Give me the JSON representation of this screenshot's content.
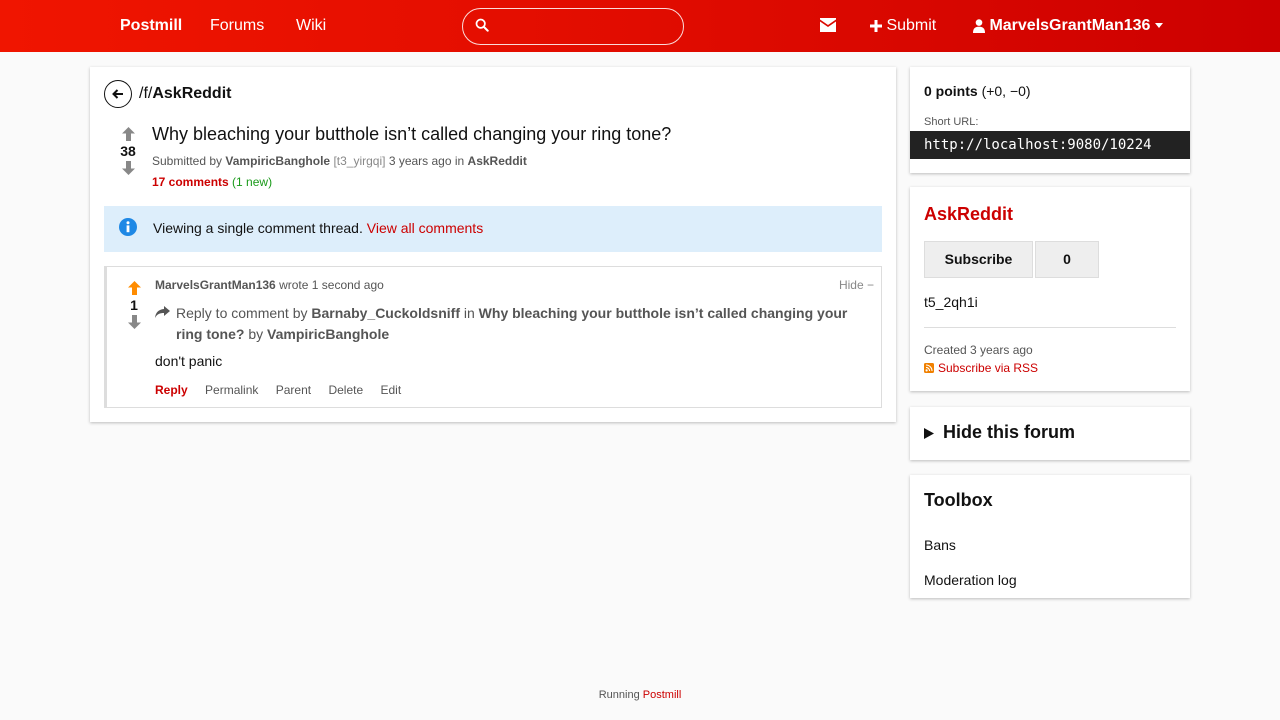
{
  "colors": {
    "brand": "#e10c00",
    "accent": "#cc0000",
    "upvote": "#ff8c00",
    "new": "#1a9a1a",
    "info": "#1e88e5"
  },
  "header": {
    "brand": "Postmill",
    "nav": {
      "forums": "Forums",
      "wiki": "Wiki"
    },
    "search": {
      "value": "",
      "placeholder": ""
    },
    "submit": "Submit",
    "user": "MarvelsGrantMan136",
    "icons": {
      "search": "search-icon",
      "mail": "envelope-icon",
      "submit": "plus-icon",
      "user": "user-icon",
      "caret": "caret-down-icon"
    }
  },
  "post": {
    "forum_prefix": "/f/",
    "forum": "AskReddit",
    "score": "38",
    "title": "Why bleaching your butthole isn’t called changing your ring tone?",
    "meta": {
      "submitted_by": "Submitted by",
      "author": "VampiricBanghole",
      "flair": "[t3_yirgqi]",
      "time": "3 years ago in",
      "forum": "AskReddit"
    },
    "comments": "17 comments",
    "new_comments": "(1 new)"
  },
  "alert": {
    "text": "Viewing a single comment thread.",
    "link": "View all comments"
  },
  "comment": {
    "score": "1",
    "author": "MarvelsGrantMan136",
    "wrote": "wrote 1 second ago",
    "hide": "Hide −",
    "reply_prefix": "Reply to comment by",
    "reply_to": "Barnaby_Cuckoldsniff",
    "in": "in",
    "thread_title": "Why bleaching your butthole isn’t called changing your ring tone?",
    "by": "by",
    "thread_author": "VampiricBanghole",
    "body": "don't panic",
    "actions": {
      "reply": "Reply",
      "permalink": "Permalink",
      "parent": "Parent",
      "delete": "Delete",
      "edit": "Edit"
    }
  },
  "sidebar": {
    "points": {
      "value": "0 points",
      "detail": "(+0, −0)"
    },
    "short_url_label": "Short URL:",
    "short_url": "http://localhost:9080/10224",
    "forum": {
      "name": "AskReddit",
      "subscribe": "Subscribe",
      "subscribers": "0",
      "id": "t5_2qh1i",
      "created": "Created 3 years ago",
      "rss": "Subscribe via RSS"
    },
    "hide_forum": "Hide this forum",
    "toolbox": {
      "title": "Toolbox",
      "bans": "Bans",
      "modlog": "Moderation log"
    }
  },
  "footer": {
    "prefix": "Running",
    "link": "Postmill"
  }
}
